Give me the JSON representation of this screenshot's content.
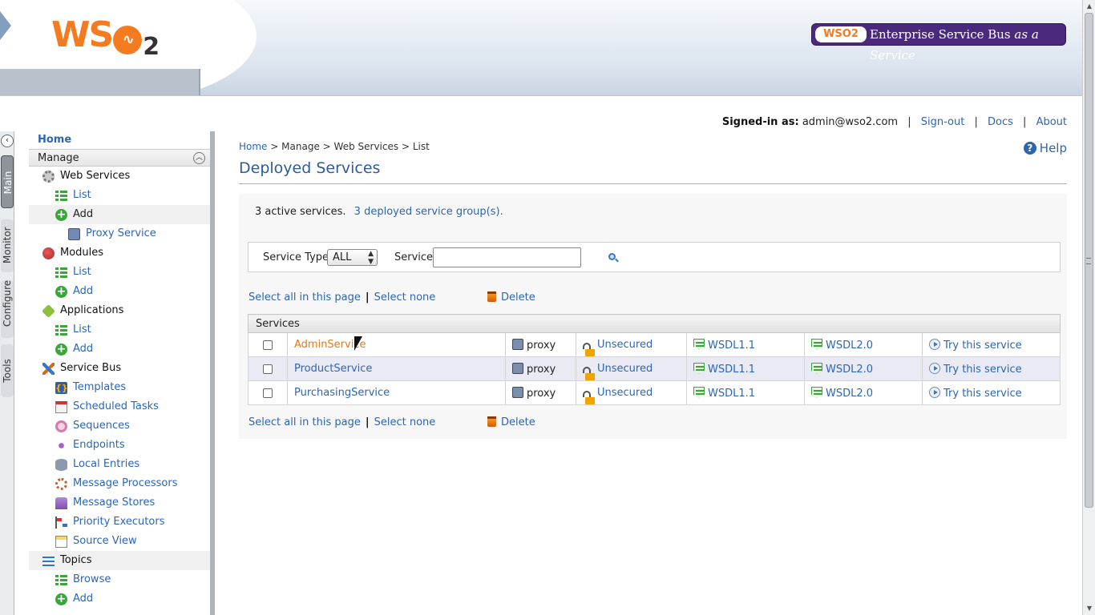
{
  "header": {
    "logo_text": "WSO2",
    "badge_mini": "WSO2",
    "badge_title": "Enterprise Service Bus",
    "badge_suffix": "as a Service"
  },
  "toplinks": {
    "signed_label": "Signed-in as:",
    "user": "admin@wso2.com",
    "signout": "Sign-out",
    "docs": "Docs",
    "about": "About"
  },
  "vtabs": [
    "Main",
    "Monitor",
    "Configure",
    "Tools"
  ],
  "nav": {
    "home": "Home",
    "manage": "Manage",
    "web_services": "Web Services",
    "ws_list": "List",
    "ws_add": "Add",
    "proxy_service": "Proxy Service",
    "modules": "Modules",
    "mod_list": "List",
    "mod_add": "Add",
    "applications": "Applications",
    "app_list": "List",
    "app_add": "Add",
    "service_bus": "Service Bus",
    "templates": "Templates",
    "scheduled_tasks": "Scheduled Tasks",
    "sequences": "Sequences",
    "endpoints": "Endpoints",
    "local_entries": "Local Entries",
    "message_processors": "Message Processors",
    "message_stores": "Message Stores",
    "priority_executors": "Priority Executors",
    "source_view": "Source View",
    "topics": "Topics",
    "browse": "Browse",
    "topics_add": "Add"
  },
  "breadcrumb": {
    "home": "Home",
    "manage": "Manage",
    "web_services": "Web Services",
    "list": "List",
    "sep": ">"
  },
  "help": "Help",
  "page_title": "Deployed Services",
  "counts": {
    "active": "3 active services.",
    "groups": "3 deployed service group(s)."
  },
  "filter": {
    "type_label": "Service Type",
    "type_value": "ALL",
    "service_label": "Service",
    "service_value": ""
  },
  "selection": {
    "select_all": "Select all in this page",
    "separator": "|",
    "select_none": "Select none",
    "delete": "Delete"
  },
  "table": {
    "header": "Services",
    "rows": [
      {
        "name": "AdminService",
        "type": "proxy",
        "security": "Unsecured",
        "wsdl11": "WSDL1.1",
        "wsdl20": "WSDL2.0",
        "try": "Try this service"
      },
      {
        "name": "ProductService",
        "type": "proxy",
        "security": "Unsecured",
        "wsdl11": "WSDL1.1",
        "wsdl20": "WSDL2.0",
        "try": "Try this service"
      },
      {
        "name": "PurchasingService",
        "type": "proxy",
        "security": "Unsecured",
        "wsdl11": "WSDL1.1",
        "wsdl20": "WSDL2.0",
        "try": "Try this service"
      }
    ]
  },
  "colors": {
    "link": "#2d66b0",
    "active_link": "#e47a1d",
    "badge": "#4b2a7e",
    "brand_orange": "#f47b20"
  }
}
